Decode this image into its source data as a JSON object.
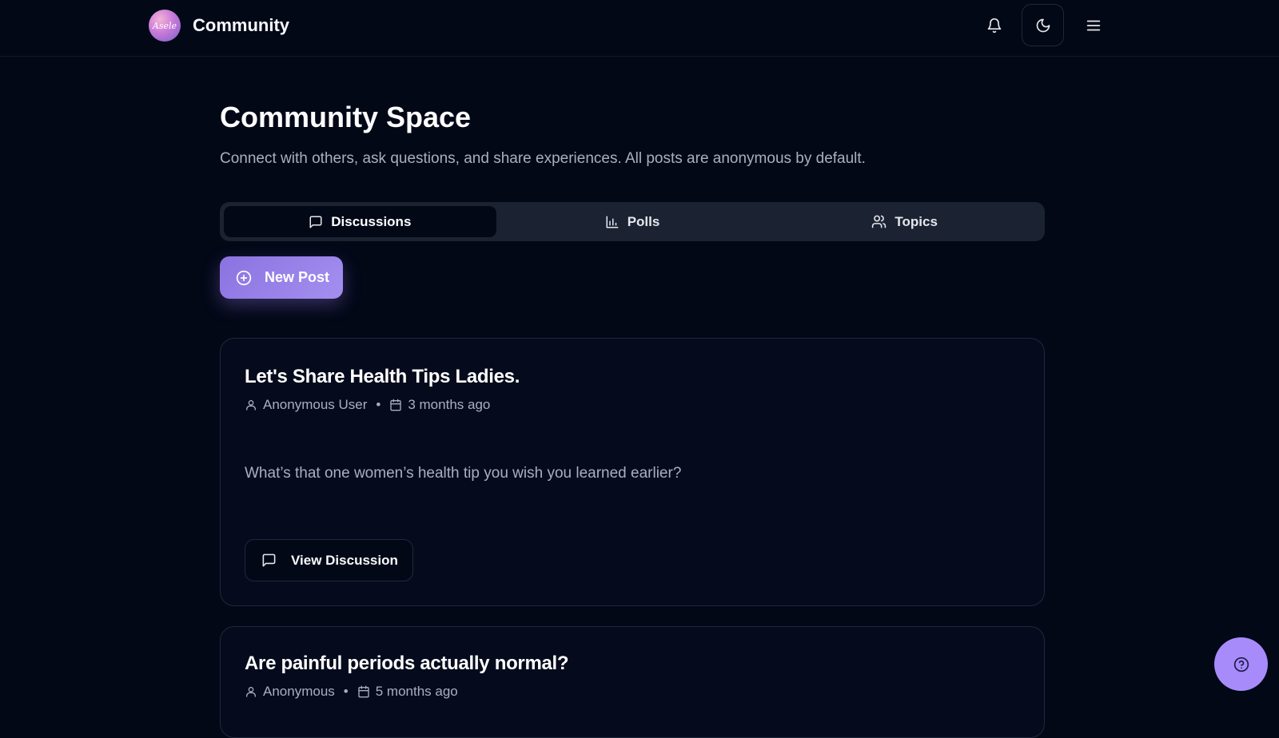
{
  "header": {
    "logo_text": "Asele",
    "app_title": "Community",
    "notifications_icon": "bell-icon",
    "theme_icon": "moon-icon",
    "menu_icon": "menu-icon"
  },
  "page": {
    "title": "Community Space",
    "subtitle": "Connect with others, ask questions, and share experiences. All posts are anonymous by default."
  },
  "tabs": [
    {
      "label": "Discussions",
      "icon": "message-square-icon",
      "active": true
    },
    {
      "label": "Polls",
      "icon": "bar-chart-icon",
      "active": false
    },
    {
      "label": "Topics",
      "icon": "users-icon",
      "active": false
    }
  ],
  "actions": {
    "new_post_label": "New Post",
    "new_post_icon": "plus-circle-icon"
  },
  "posts": [
    {
      "title": "Let's Share Health Tips Ladies.",
      "author": "Anonymous User",
      "date": "3 months ago",
      "body": "What’s that one women’s health tip you wish you learned earlier?",
      "button_label": "View Discussion"
    },
    {
      "title": "Are painful periods actually normal?",
      "author": "Anonymous",
      "date": "5 months ago"
    }
  ],
  "meta_separator": "•",
  "help_icon": "help-circle-icon",
  "colors": {
    "background": "#030817",
    "accent": "#a78bfa",
    "muted_text": "#a7b0c0",
    "border": "#1e293b"
  }
}
